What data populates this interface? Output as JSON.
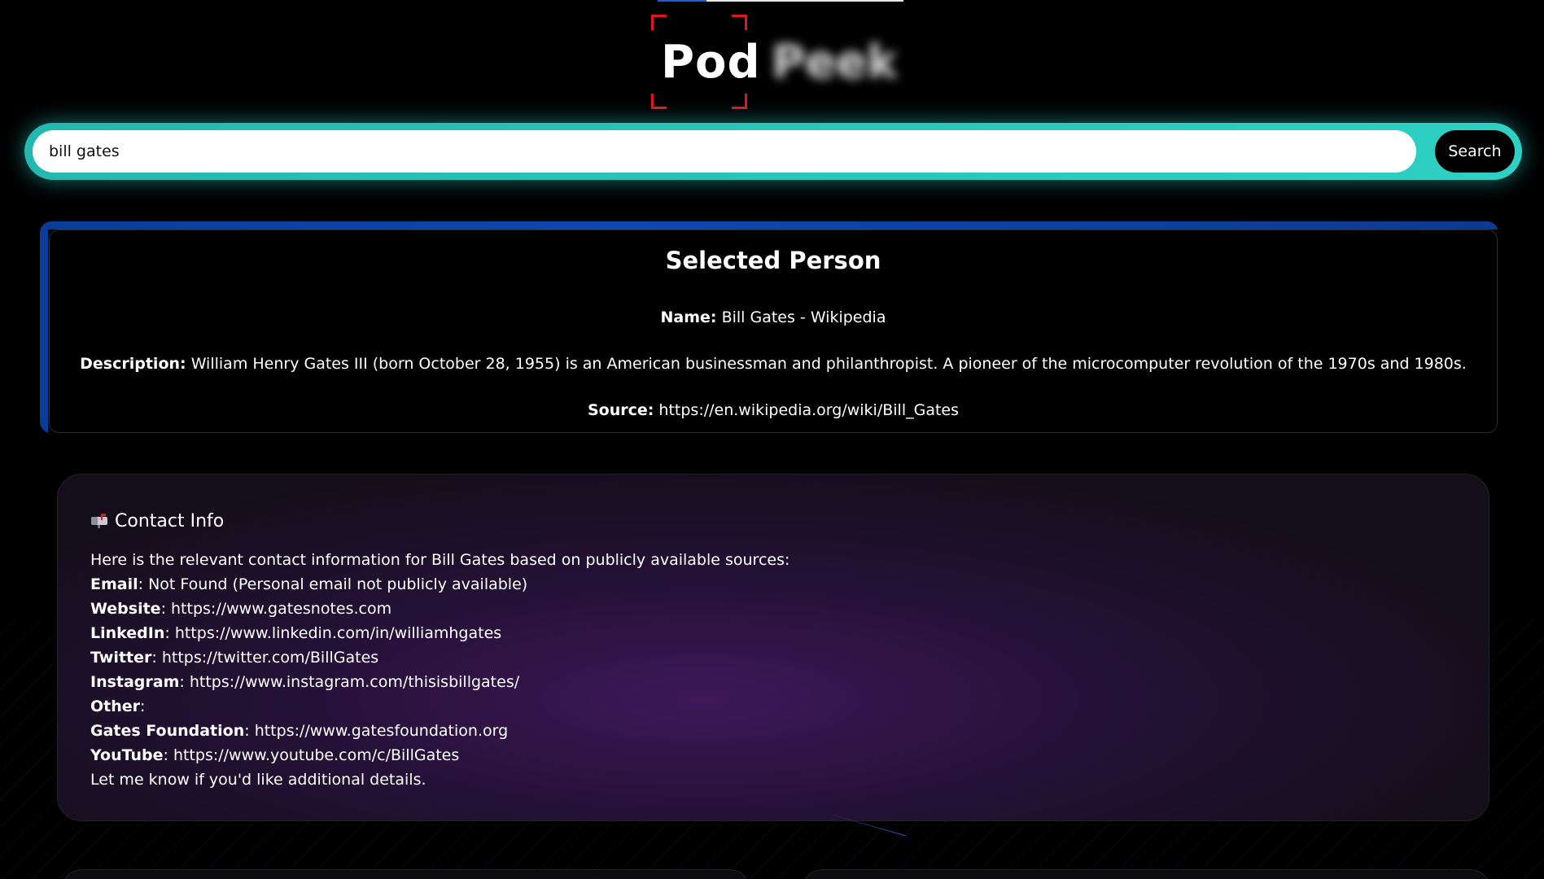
{
  "logo": {
    "word1": "Pod",
    "word2": "Peek"
  },
  "search": {
    "value": "bill gates",
    "button_label": "Search"
  },
  "selected_person": {
    "title": "Selected Person",
    "name_label": "Name:",
    "name_value": "Bill Gates - Wikipedia",
    "description_label": "Description:",
    "description_value": "William Henry Gates III (born October 28, 1955) is an American businessman and philanthropist. A pioneer of the microcomputer revolution of the 1970s and 1980s.",
    "source_label": "Source:",
    "source_value": "https://en.wikipedia.org/wiki/Bill_Gates"
  },
  "contact_info": {
    "icon": "mailbox-icon",
    "title": "Contact Info",
    "intro": "Here is the relevant contact information for Bill Gates based on publicly available sources:",
    "rows": [
      {
        "label": "Email",
        "value": "Not Found (Personal email not publicly available)"
      },
      {
        "label": "Website",
        "value": "https://www.gatesnotes.com"
      },
      {
        "label": "LinkedIn",
        "value": "https://www.linkedin.com/in/williamhgates"
      },
      {
        "label": "Twitter",
        "value": "https://twitter.com/BillGates"
      },
      {
        "label": "Instagram",
        "value": "https://www.instagram.com/thisisbillgates/"
      },
      {
        "label": "Other",
        "value": ""
      },
      {
        "label": "Gates Foundation",
        "value": "https://www.gatesfoundation.org"
      },
      {
        "label": "YouTube",
        "value": "https://www.youtube.com/c/BillGates"
      }
    ],
    "outro": "Let me know if you'd like additional details."
  },
  "colors": {
    "accent_teal": "#2ed0c4",
    "logo_bracket_red": "#e0161f",
    "card_blue_edge": "#0d47b0",
    "contact_purple": "#46196a"
  }
}
